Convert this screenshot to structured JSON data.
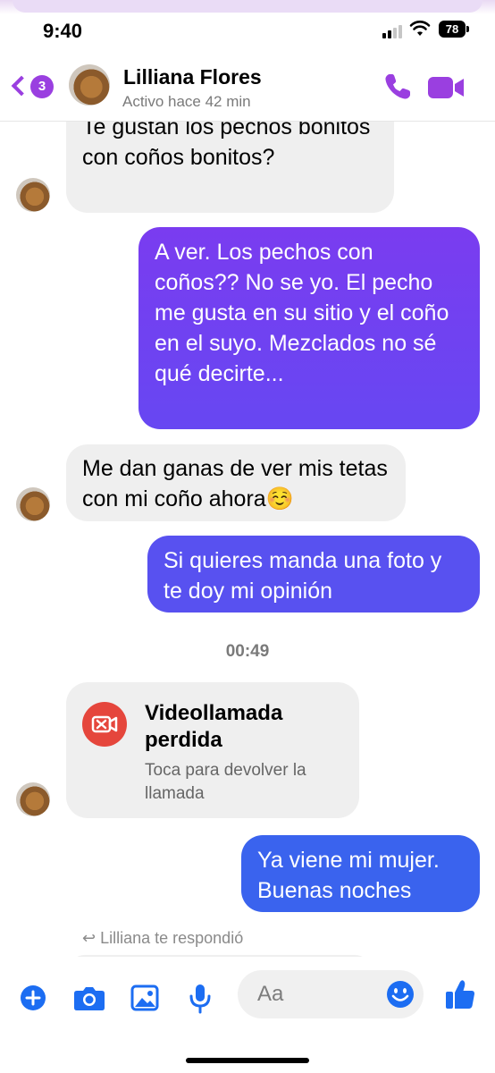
{
  "status_bar": {
    "time": "9:40",
    "battery": "78"
  },
  "header": {
    "back_badge": "3",
    "contact_name": "Lilliana Flores",
    "contact_status": "Activo hace 42 min"
  },
  "messages": [
    {
      "from": "them",
      "text": "Te gustan los pechos bonitos con coños bonitos?"
    },
    {
      "from": "me",
      "text": "A ver. Los pechos con coños?? No se yo.  El pecho me gusta en su sitio y el coño en el suyo. Mezclados no sé qué decirte..."
    },
    {
      "from": "them",
      "text": "Me dan ganas de ver mis tetas con mi coño ahora☺️"
    },
    {
      "from": "me",
      "text": "Si quieres manda una foto y te doy mi opinión"
    }
  ],
  "timestamp": "00:49",
  "missed_call": {
    "title": "Videollamada perdida",
    "subtitle": "Toca para devolver la llamada"
  },
  "last_message": {
    "from": "me",
    "text": "Ya viene mi mujer. Buenas noches"
  },
  "reply_notice": "Lilliana te respondió",
  "composer": {
    "placeholder": "Aa"
  },
  "colors": {
    "accent_purple": "#9a3fe0",
    "bubble_purple": "#7a3cf0",
    "bubble_blue": "#3a63ee",
    "composer_blue": "#1c6df2",
    "missed_red": "#e5463c"
  },
  "icons": [
    "back-chevron-icon",
    "phone-icon",
    "video-camera-icon",
    "plus-icon",
    "camera-icon",
    "image-icon",
    "microphone-icon",
    "emoji-icon",
    "thumbs-up-icon"
  ]
}
